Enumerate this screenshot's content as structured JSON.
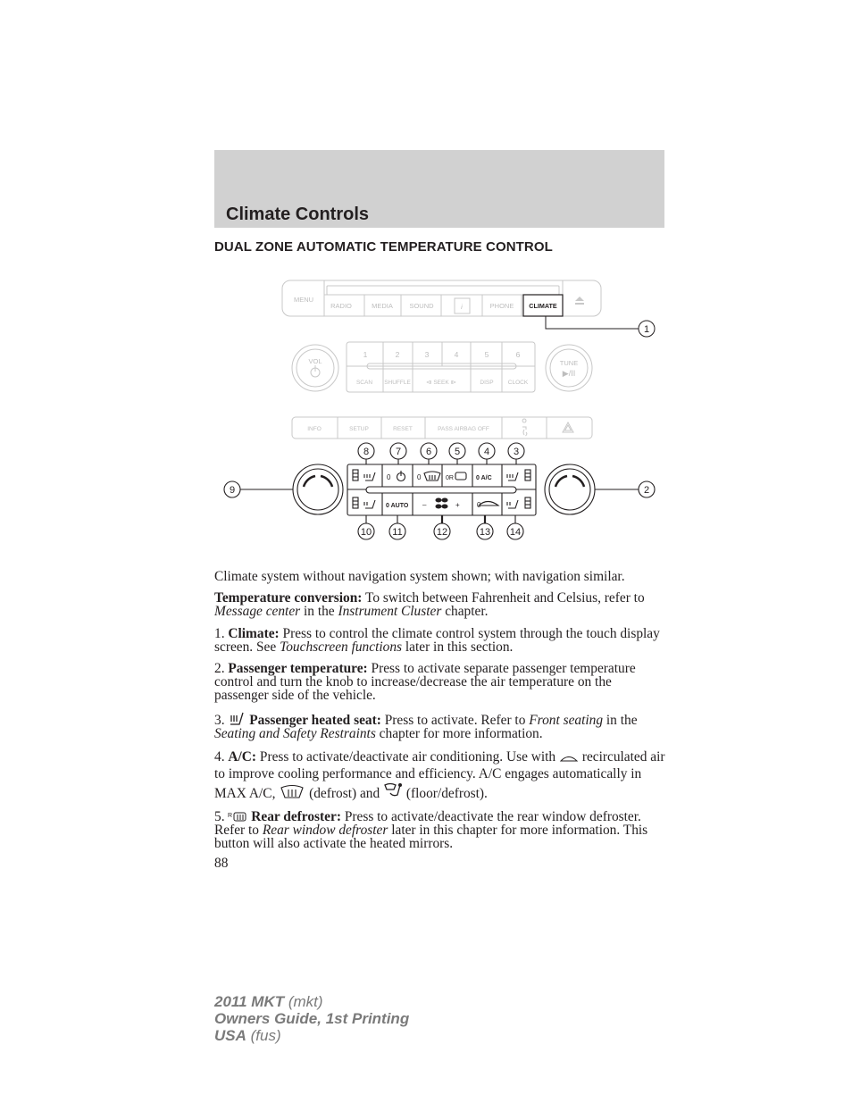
{
  "chapter_title": "Climate Controls",
  "section_title": "DUAL ZONE AUTOMATIC TEMPERATURE CONTROL",
  "figure": {
    "top_row_buttons": [
      "MENU",
      "RADIO",
      "MEDIA",
      "SOUND",
      "i",
      "PHONE",
      "CLIMATE"
    ],
    "eject_icon": "eject-icon",
    "vol_label": "VOL",
    "tune_label": "TUNE",
    "tune_sub": "▶/II",
    "preset_numbers": [
      "1",
      "2",
      "3",
      "4",
      "5",
      "6"
    ],
    "preset_functions": [
      "SCAN",
      "SHUFFLE",
      "⧏  SEEK  ⧐",
      "DISP",
      "CLOCK"
    ],
    "third_row_buttons": [
      "INFO",
      "SETUP",
      "RESET",
      "PASS AIRBAG OFF"
    ],
    "climate_top_labels": [
      "",
      "0",
      "0",
      "0R",
      "0  A/C",
      ""
    ],
    "climate_bottom_labels": [
      "",
      "0 AUTO",
      "–",
      "+",
      "0",
      ""
    ],
    "callouts": [
      "1",
      "2",
      "3",
      "4",
      "5",
      "6",
      "7",
      "8",
      "9",
      "10",
      "11",
      "12",
      "13",
      "14"
    ]
  },
  "body": {
    "caption": "Climate system without navigation system shown; with navigation similar.",
    "temp_conv": {
      "label": "Temperature conversion:",
      "text1": " To switch between Fahrenheit and Celsius, refer to ",
      "link1": "Message center",
      "text2": " in the ",
      "link2": "Instrument Cluster",
      "text3": " chapter."
    },
    "item1": {
      "num": "1. ",
      "label": "Climate:",
      "text1": " Press to control the climate control system through the touch display screen. See ",
      "link": "Touchscreen functions",
      "text2": " later in this section."
    },
    "item2": {
      "num": "2. ",
      "label": "Passenger temperature:",
      "text": " Press to activate separate passenger temperature control and turn the knob to increase/decrease the air temperature on the passenger side of the vehicle."
    },
    "item3": {
      "num": "3. ",
      "label": "Passenger heated seat:",
      "text1": " Press to activate. Refer to ",
      "link1": "Front seating",
      "text2": " in the ",
      "link2": "Seating and Safety Restraints",
      "text3": " chapter for more information."
    },
    "item4": {
      "num": "4. ",
      "label": "A/C:",
      "text1": " Press to activate/deactivate air conditioning. Use with ",
      "text2": " recirculated air to improve cooling performance and efficiency. A/C engages automatically in MAX A/C, ",
      "text3": " (defrost) and ",
      "text4": " (floor/defrost)."
    },
    "item5": {
      "num": "5. ",
      "label": "Rear defroster:",
      "text1": " Press to activate/deactivate the rear window defroster. Refer to ",
      "link": "Rear window defroster",
      "text2": " later in this chapter for more information. This button will also activate the heated mirrors."
    },
    "page_number": "88"
  },
  "footer": {
    "line1_bold": "2011 MKT",
    "line1_rest": " (mkt)",
    "line2_bold": "Owners Guide, 1st Printing",
    "line3_bold": "USA",
    "line3_rest": " (fus)"
  }
}
